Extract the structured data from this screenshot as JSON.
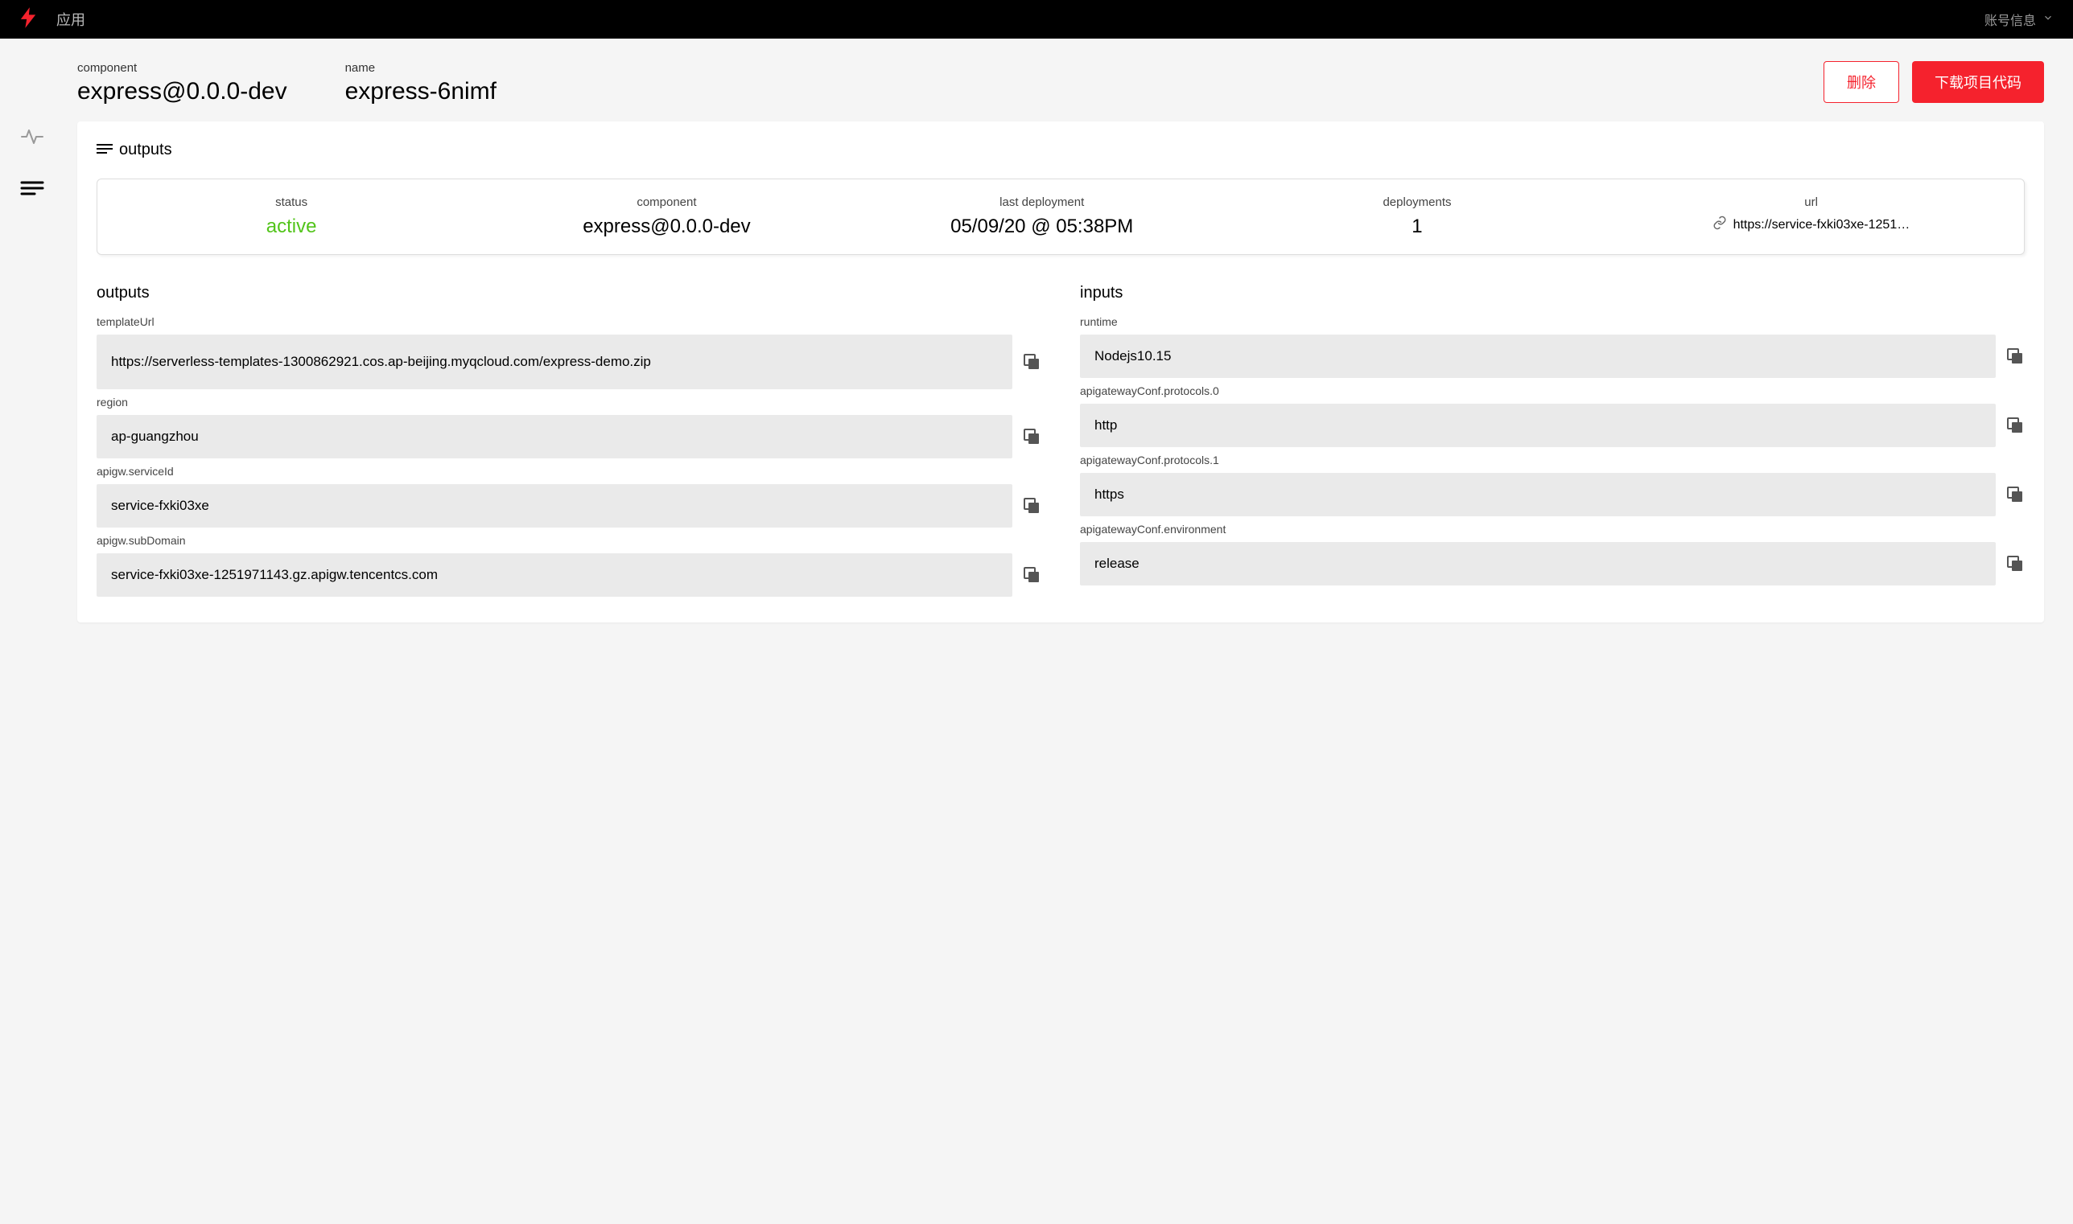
{
  "topbar": {
    "app_title": "应用",
    "account_label": "账号信息"
  },
  "header": {
    "component_label": "component",
    "component_value": "express@0.0.0-dev",
    "name_label": "name",
    "name_value": "express-6nimf",
    "delete_label": "删除",
    "download_label": "下载项目代码"
  },
  "card": {
    "title": "outputs"
  },
  "status": {
    "status_label": "status",
    "status_value": "active",
    "component_label": "component",
    "component_value": "express@0.0.0-dev",
    "last_deployment_label": "last deployment",
    "last_deployment_value": "05/09/20 @ 05:38PM",
    "deployments_label": "deployments",
    "deployments_value": "1",
    "url_label": "url",
    "url_value": "https://service-fxki03xe-125197114..."
  },
  "outputs_heading": "outputs",
  "inputs_heading": "inputs",
  "outputs": [
    {
      "key": "templateUrl",
      "value": "https://serverless-templates-1300862921.cos.ap-beijing.myqcloud.com/express-demo.zip"
    },
    {
      "key": "region",
      "value": "ap-guangzhou"
    },
    {
      "key": "apigw.serviceId",
      "value": "service-fxki03xe"
    },
    {
      "key": "apigw.subDomain",
      "value": "service-fxki03xe-1251971143.gz.apigw.tencentcs.com"
    }
  ],
  "inputs": [
    {
      "key": "runtime",
      "value": "Nodejs10.15"
    },
    {
      "key": "apigatewayConf.protocols.0",
      "value": "http"
    },
    {
      "key": "apigatewayConf.protocols.1",
      "value": "https"
    },
    {
      "key": "apigatewayConf.environment",
      "value": "release"
    }
  ]
}
